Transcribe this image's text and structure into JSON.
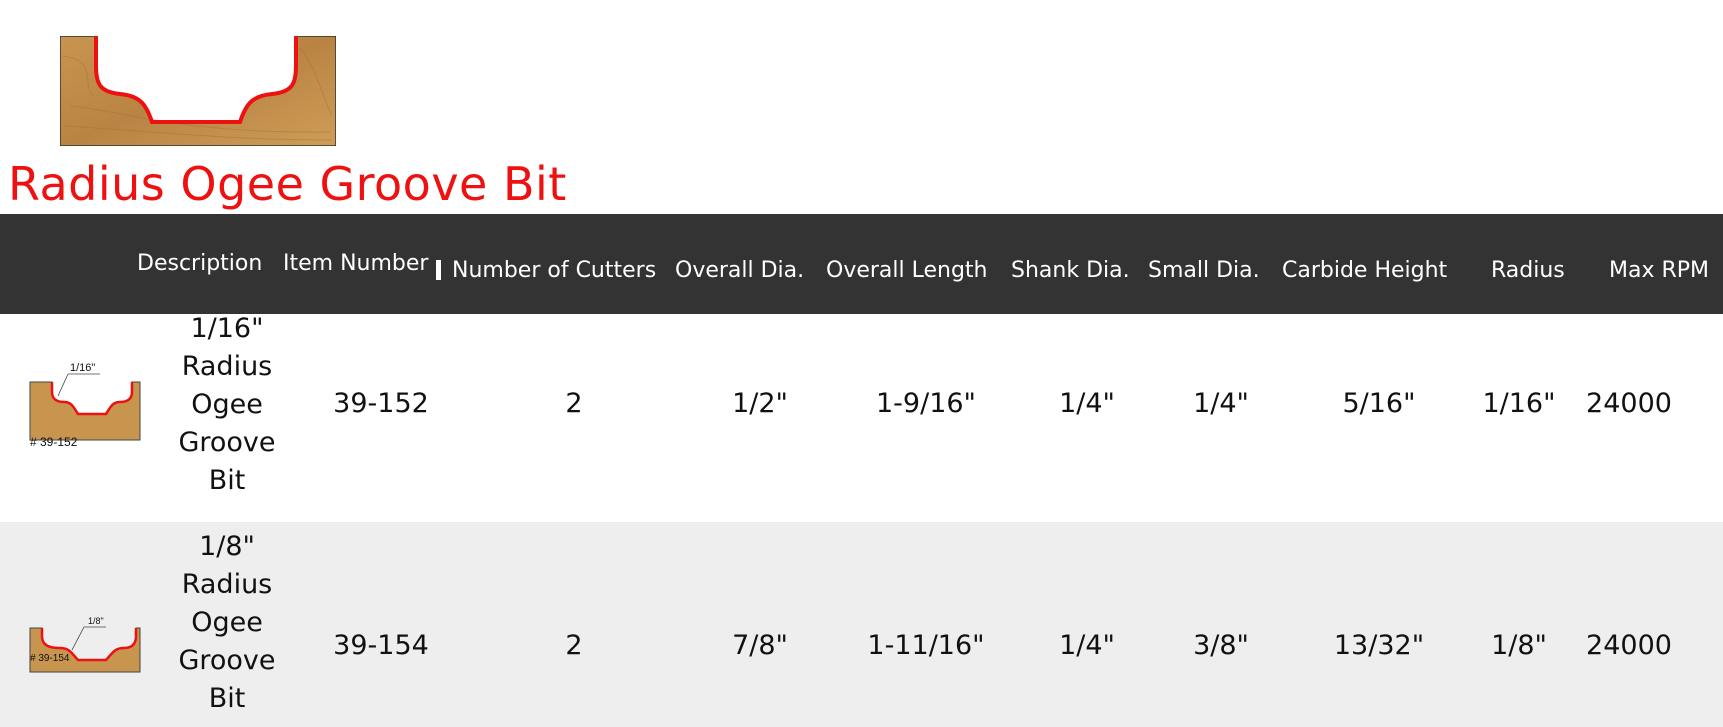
{
  "product": {
    "title": "Radius Ogee Groove Bit",
    "hero_image": "radius-ogee-groove-profile",
    "profile_color": "#ee1111",
    "wood_color": "#c8954f"
  },
  "table": {
    "header_bg": "#333333",
    "columns": [
      "Description",
      "Item Number",
      "Number of Cutters",
      "Overall Dia.",
      "Overall Length",
      "Shank Dia.",
      "Small Dia.",
      "Carbide Height",
      "Radius",
      "Max RPM"
    ],
    "rows": [
      {
        "thumb_label": "1/16\"",
        "thumb_caption": "# 39-152",
        "description_lines": [
          "1/16\"",
          "Radius",
          "Ogee",
          "Groove",
          "Bit"
        ],
        "item_number": "39-152",
        "cutters": "2",
        "overall_dia": "1/2\"",
        "overall_length": "1-9/16\"",
        "shank_dia": "1/4\"",
        "small_dia": "1/4\"",
        "carbide_height": "5/16\"",
        "radius": "1/16\"",
        "max_rpm": "24000"
      },
      {
        "thumb_label": "1/8\"",
        "thumb_caption": "# 39-154",
        "description_lines": [
          "1/8\"",
          "Radius",
          "Ogee",
          "Groove",
          "Bit"
        ],
        "item_number": "39-154",
        "cutters": "2",
        "overall_dia": "7/8\"",
        "overall_length": "1-11/16\"",
        "shank_dia": "1/4\"",
        "small_dia": "3/8\"",
        "carbide_height": "13/32\"",
        "radius": "1/8\"",
        "max_rpm": "24000"
      }
    ]
  }
}
